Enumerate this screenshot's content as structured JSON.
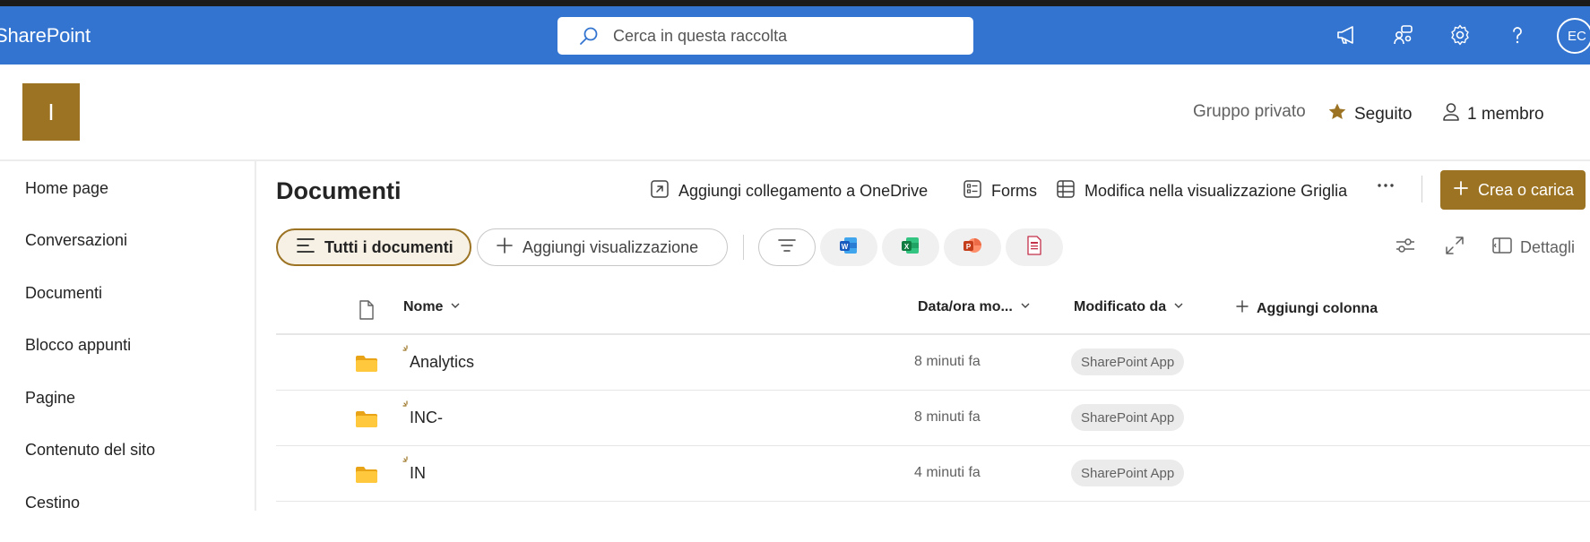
{
  "suite": {
    "brand": "SharePoint",
    "search_placeholder": "Cerca in questa raccolta",
    "avatar_initials": "EC"
  },
  "site": {
    "logo_letter": "I",
    "group_type": "Gruppo privato",
    "follow_label": "Seguito",
    "members_label": "1 membro"
  },
  "nav": {
    "items": [
      "Home page",
      "Conversazioni",
      "Documenti",
      "Blocco appunti",
      "Pagine",
      "Contenuto del sito",
      "Cestino"
    ]
  },
  "library": {
    "title": "Documenti",
    "commands": {
      "add_shortcut": "Aggiungi collegamento a OneDrive",
      "forms": "Forms",
      "grid_edit": "Modifica nella visualizzazione Griglia",
      "create_upload": "Crea o carica"
    },
    "views": {
      "all_docs": "Tutti i documenti",
      "add_view": "Aggiungi visualizzazione"
    },
    "details_label": "Dettagli",
    "columns": {
      "name": "Nome",
      "modified": "Data/ora mo...",
      "modified_by": "Modificato da",
      "add_column": "Aggiungi colonna"
    },
    "rows": [
      {
        "name": "Analytics",
        "modified": "8 minuti fa",
        "modified_by": "SharePoint App"
      },
      {
        "name": "INC-",
        "modified": "8 minuti fa",
        "modified_by": "SharePoint App"
      },
      {
        "name": "IN",
        "modified": "4 minuti fa",
        "modified_by": "SharePoint App"
      }
    ]
  },
  "colors": {
    "suite_blue": "#3374d0",
    "accent_gold": "#9b7323"
  }
}
